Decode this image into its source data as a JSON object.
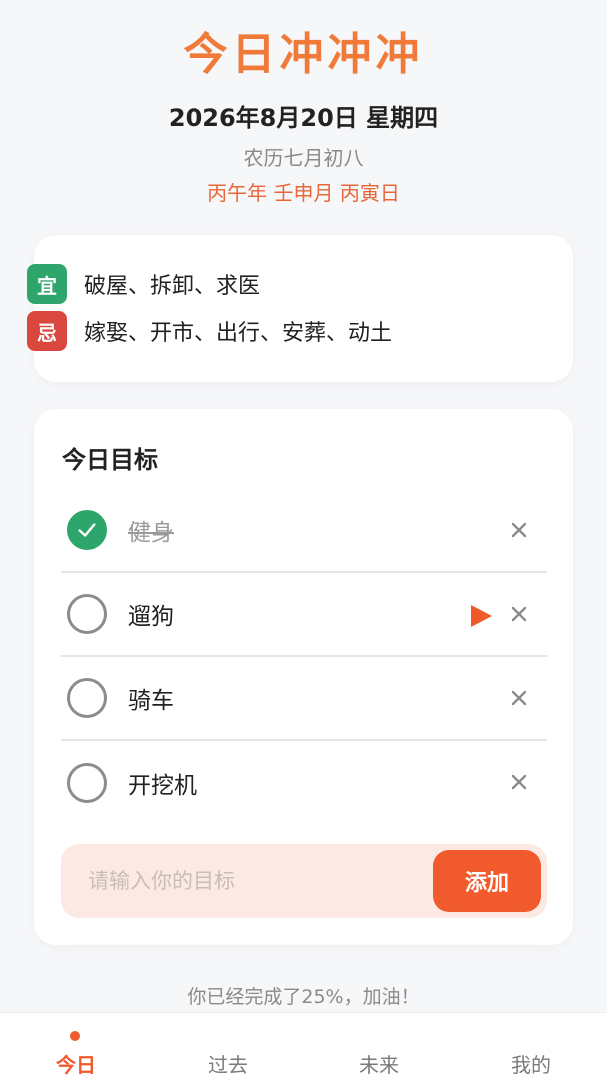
{
  "header": {
    "title": "今日冲冲冲",
    "date": "2026年8月20日 星期四",
    "lunar": "农历七月初八",
    "ganzhi": "丙午年 壬申月 丙寅日"
  },
  "almanac": {
    "good": {
      "badge": "宜",
      "text": "破屋、拆卸、求医",
      "color": "#2ea56a"
    },
    "bad": {
      "badge": "忌",
      "text": "嫁娶、开市、出行、安葬、动土",
      "color": "#d9473f"
    }
  },
  "goals": {
    "title": "今日目标",
    "items": [
      {
        "text": "健身",
        "done": true,
        "playing": false
      },
      {
        "text": "遛狗",
        "done": false,
        "playing": true
      },
      {
        "text": "骑车",
        "done": false,
        "playing": false
      },
      {
        "text": "开挖机",
        "done": false,
        "playing": false
      }
    ],
    "input": {
      "value": "",
      "placeholder": "请输入你的目标"
    },
    "add_label": "添加"
  },
  "progress": {
    "percent": 25,
    "text": "你已经完成了25%，加油！"
  },
  "tabbar": {
    "tabs": [
      {
        "label": "今日",
        "active": true
      },
      {
        "label": "过去",
        "active": false
      },
      {
        "label": "未来",
        "active": false
      },
      {
        "label": "我的",
        "active": false
      }
    ]
  },
  "colors": {
    "accent": "#f05a2c",
    "title": "#f07a3a",
    "done": "#2ea56a"
  }
}
